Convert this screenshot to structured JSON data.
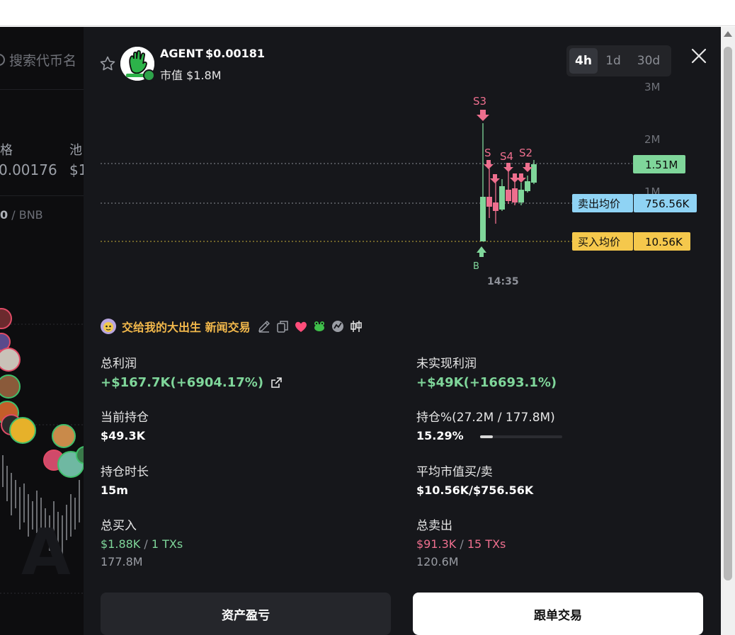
{
  "background": {
    "search_placeholder": "搜索代币名",
    "col_price_label": "格",
    "col_pool_label": "池",
    "price_value": "0.00176",
    "pool_value": "$1",
    "bnb_prefix": "0",
    "bnb_label": "/ BNB",
    "big_text": "A"
  },
  "token": {
    "name": "AGENT",
    "price": "$0.00181",
    "market_cap": "市值 $1.8M"
  },
  "timeframes": [
    {
      "label": "4h",
      "active": true
    },
    {
      "label": "1d",
      "active": false
    },
    {
      "label": "30d",
      "active": false
    }
  ],
  "chart_data": {
    "type": "candlestick",
    "y_ticks": [
      "3M",
      "2M",
      "1M"
    ],
    "x_tick": "14:35",
    "current_price_tag": "1.51M",
    "sell_avg_label": "卖出均价",
    "sell_avg_value": "756.56K",
    "buy_avg_label": "买入均价",
    "buy_avg_value": "10.56K",
    "markers": [
      {
        "label": "S3",
        "kind": "sell"
      },
      {
        "label": "S",
        "kind": "sell"
      },
      {
        "label": "S4",
        "kind": "sell"
      },
      {
        "label": "S2",
        "kind": "sell"
      },
      {
        "label": "B",
        "kind": "buy"
      }
    ],
    "colors": {
      "up": "#7fd69a",
      "down": "#ee6f8e",
      "sell_tag": "#8fd3f4",
      "buy_tag": "#f5c84c"
    }
  },
  "trader": {
    "name": "交给我的大出生 新闻交易"
  },
  "stats": {
    "total_profit_label": "总利润",
    "total_profit_value": "+$167.7K(+6904.17%)",
    "unrealized_label": "未实现利润",
    "unrealized_value": "+$49K(+16693.1%)",
    "holding_label": "当前持仓",
    "holding_value": "$49.3K",
    "holding_pct_label": "持仓%(27.2M / 177.8M)",
    "holding_pct_value": "15.29%",
    "holding_pct_fraction": 0.1529,
    "duration_label": "持仓时长",
    "duration_value": "15m",
    "avg_mcap_label": "平均市值买/卖",
    "avg_mcap_value": "$10.56K/$756.56K",
    "total_buy_label": "总买入",
    "total_buy_amount": "$1.88K",
    "total_buy_sep": "/",
    "total_buy_txs": "1 TXs",
    "total_buy_tokens": "177.8M",
    "total_sell_label": "总卖出",
    "total_sell_amount": "$91.3K",
    "total_sell_sep": "/",
    "total_sell_txs": "15 TXs",
    "total_sell_tokens": "120.6M"
  },
  "buttons": {
    "pnl": "资产盈亏",
    "copy_trade": "跟单交易"
  }
}
